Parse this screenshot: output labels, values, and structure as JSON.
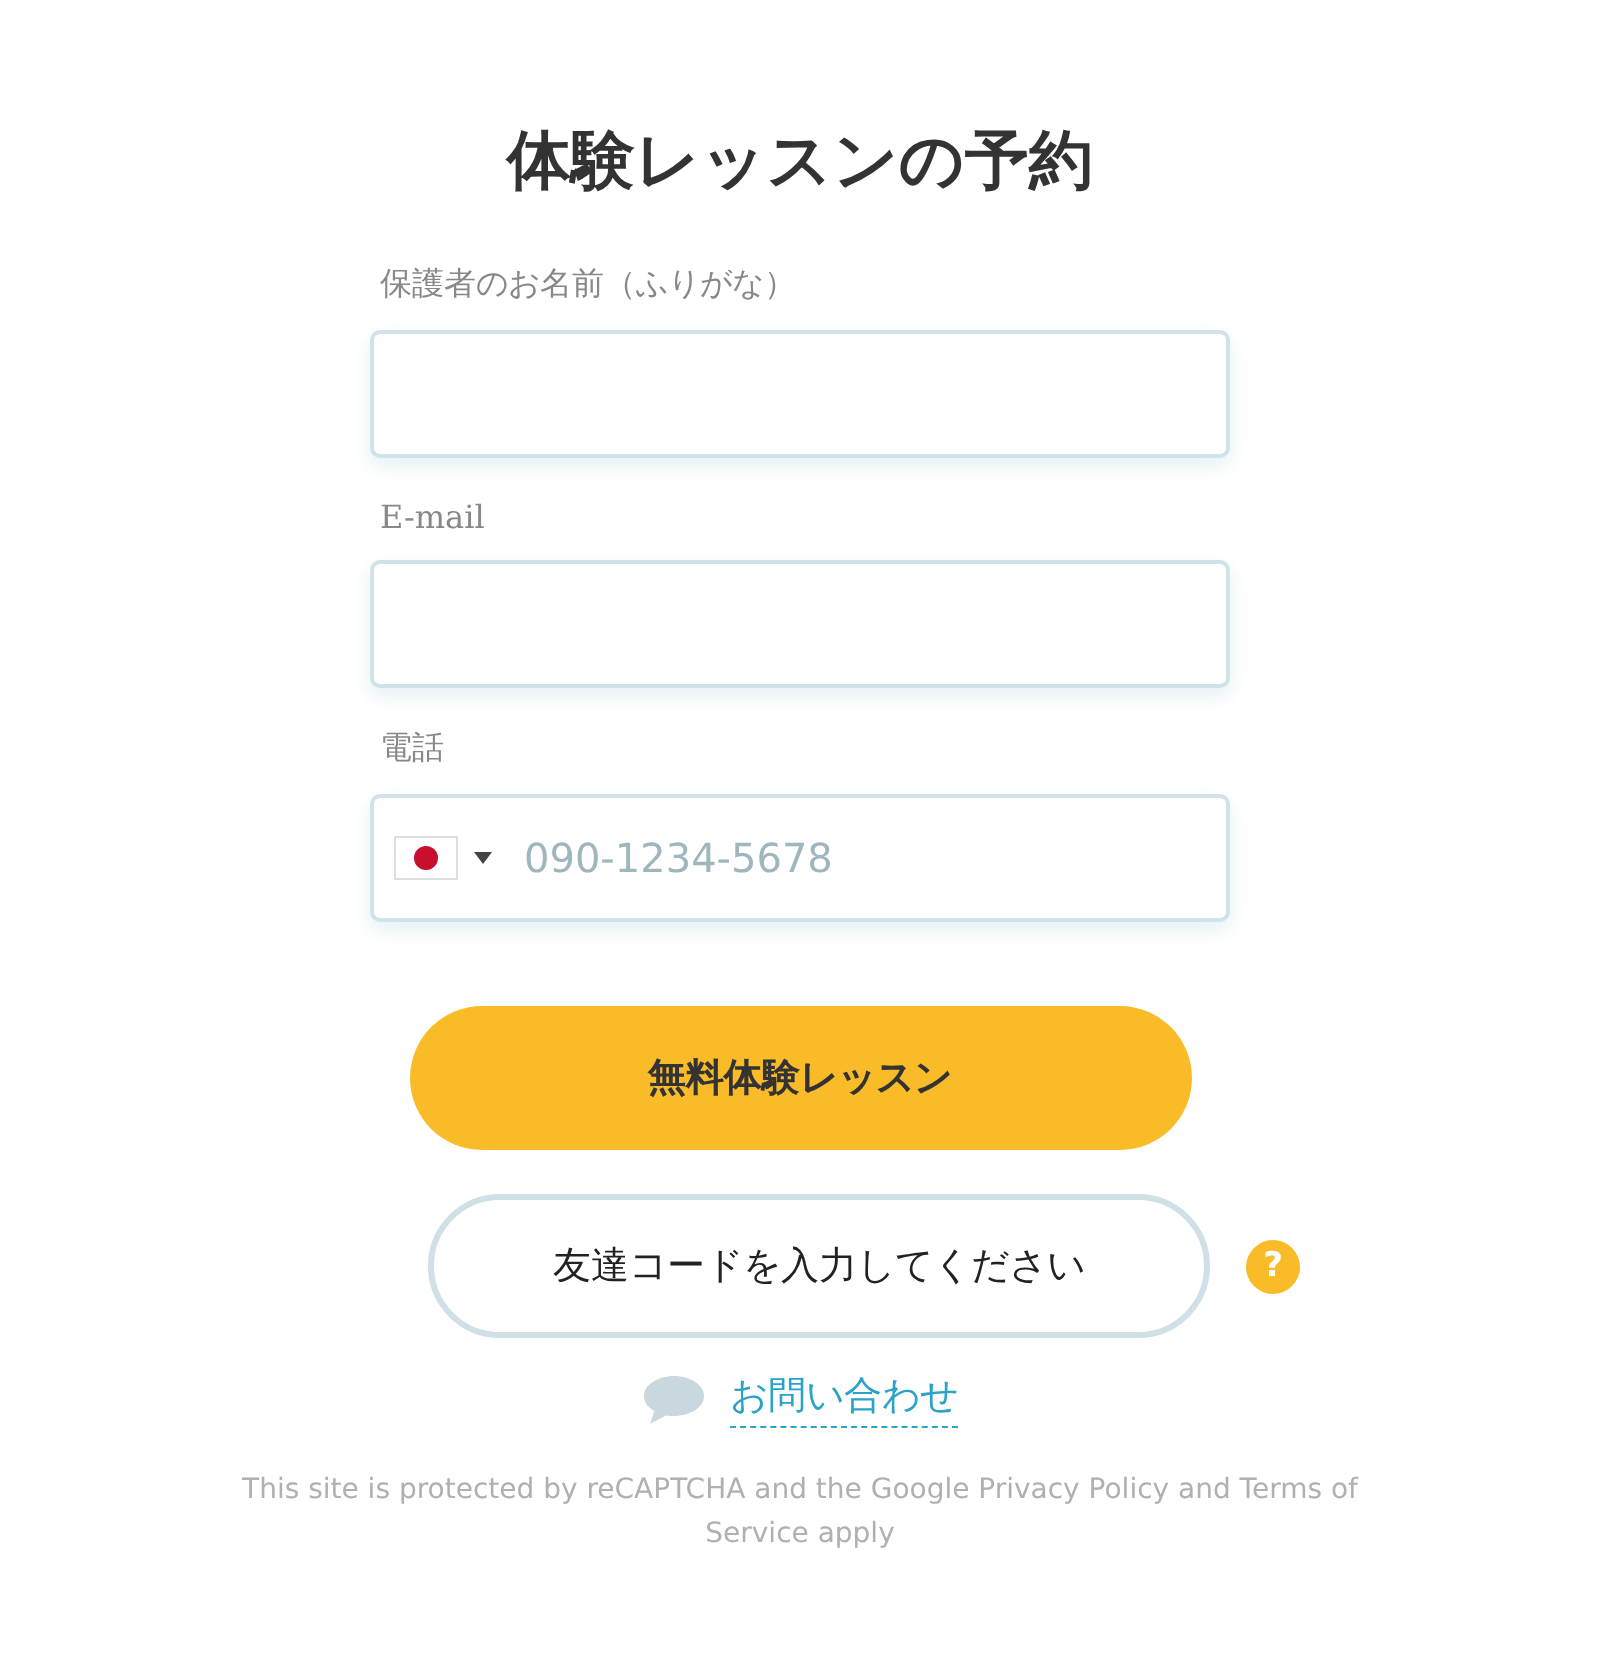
{
  "title": "体験レッスンの予約",
  "fields": [
    {
      "kind": "text",
      "label": "保護者のお名前（ふりがな）"
    },
    {
      "kind": "text",
      "label": "E-mail"
    },
    {
      "kind": "phone",
      "label": "電話",
      "placeholder": "090-1234-5678"
    }
  ],
  "submit_button": "無料体験レッスン",
  "referral_button": "友達コードを入力してください",
  "help_icon": "?",
  "contact_link": "お問い合わせ",
  "notice": "This site is protected by reCAPTCHA and the Google Privacy Policy and Terms of Service apply"
}
